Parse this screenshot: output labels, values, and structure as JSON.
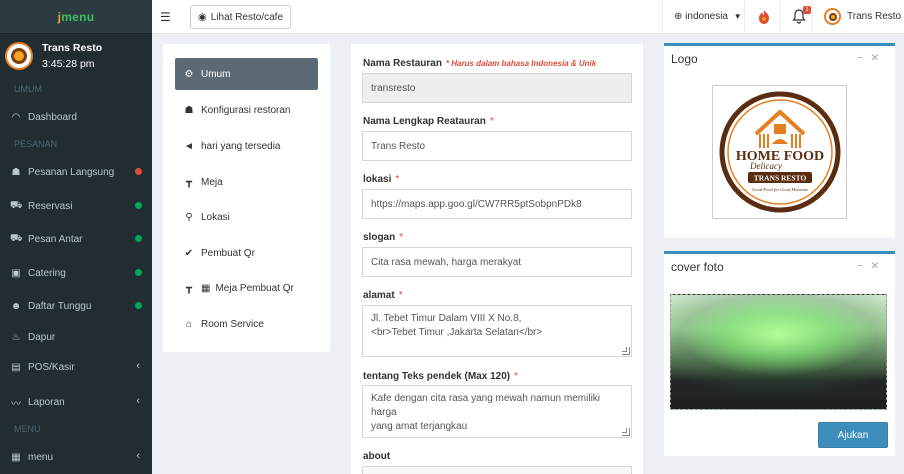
{
  "brand": {
    "logo_a": "j",
    "logo_b": "menu"
  },
  "sidebar": {
    "user_name": "Trans Resto",
    "time": "3:45:28 pm",
    "section_umum": "UMUM",
    "section_pesanan": "PESANAN",
    "section_menu": "MENU",
    "items": [
      {
        "label": "Dashboard",
        "icon": "gauge-icon"
      },
      {
        "label": "Pesanan Langsung",
        "icon": "user-tie-icon",
        "status": "red"
      },
      {
        "label": "Reservasi",
        "icon": "car-icon",
        "status": "green"
      },
      {
        "label": "Pesan Antar",
        "icon": "truck-icon",
        "status": "green"
      },
      {
        "label": "Catering",
        "icon": "gift-icon",
        "status": "green"
      },
      {
        "label": "Daftar Tunggu",
        "icon": "user-icon",
        "status": "green"
      },
      {
        "label": "Dapur",
        "icon": "fire-icon"
      },
      {
        "label": "POS/Kasir",
        "icon": "cash-register-icon"
      },
      {
        "label": "Laporan",
        "icon": "chart-line-icon"
      },
      {
        "label": "menu",
        "icon": "clipboard-icon"
      }
    ]
  },
  "topbar": {
    "view_button": "Lihat Resto/cafe",
    "language": "indonesia",
    "notif_count": "1",
    "user_name": "Trans Resto"
  },
  "settings_nav": [
    {
      "label": "Umum",
      "active": true
    },
    {
      "label": "Konfigurasi restoran"
    },
    {
      "label": "hari yang tersedia"
    },
    {
      "label": "Meja"
    },
    {
      "label": "Lokasi"
    },
    {
      "label": "Pembuat Qr"
    },
    {
      "label": "Meja Pembuat Qr"
    },
    {
      "label": "Room Service"
    }
  ],
  "form": {
    "restaurant_name_label": "Nama Restauran",
    "restaurant_name_note": "* Harus dalam bahasa Indonesia & Unik",
    "restaurant_name_value": "transresto",
    "full_name_label": "Nama Lengkap Reatauran",
    "full_name_value": "Trans Resto",
    "location_label": "lokasi",
    "location_value": "https://maps.app.goo.gl/CW7RR5ptSobpnPDk8",
    "slogan_label": "slogan",
    "slogan_value": "Cita rasa mewah, harga merakyat",
    "address_label": "alamat",
    "address_line1": "Jl. Tebet Timur Dalam VIII X No.8,",
    "address_line2": "<br>Tebet Timur ,Jakarta Selatan</br>",
    "short_text_label": "tentang Teks pendek (Max 120)",
    "short_text_line1": "Kafe dengan cita rasa yang mewah namun memiliki harga",
    "short_text_line2": "yang amat terjangkau",
    "about_label": "about",
    "required_mark": "*"
  },
  "logo_box": {
    "title": "Logo",
    "logo_text_home": "HOME FOOD",
    "logo_text_delicacy": "Delicacy",
    "logo_text_trans": "TRANS RESTO",
    "logo_text_tagline": "Good Food for Good Moments"
  },
  "cover_box": {
    "title": "cover foto",
    "apply_button": "Ajukan"
  },
  "colors": {
    "sidebar_bg": "#222d32",
    "accent": "#3c8dbc",
    "active_nav": "#5c6a76",
    "status_green": "#00a65a",
    "status_red": "#dd4b39"
  }
}
